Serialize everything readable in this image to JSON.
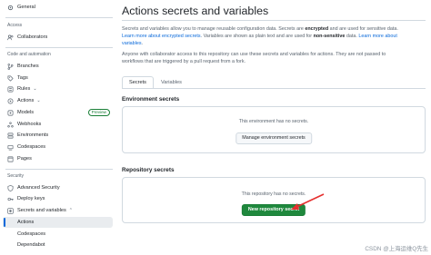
{
  "sidebar": {
    "general": "General",
    "access_heading": "Access",
    "collaborators": "Collaborators",
    "code_heading": "Code and automation",
    "branches": "Branches",
    "tags": "Tags",
    "rules": "Rules",
    "actions": "Actions",
    "models": "Models",
    "models_badge": "Preview",
    "webhooks": "Webhooks",
    "environments": "Environments",
    "codespaces": "Codespaces",
    "pages": "Pages",
    "security_heading": "Security",
    "advanced_security": "Advanced Security",
    "deploy_keys": "Deploy keys",
    "secrets_variables": "Secrets and variables",
    "sub_actions": "Actions",
    "sub_codespaces": "Codespaces",
    "sub_dependabot": "Dependabot"
  },
  "main": {
    "title": "Actions secrets and variables",
    "para1": {
      "t1": "Secrets and variables allow you to manage reusable configuration data. Secrets are ",
      "b1": "encrypted",
      "t2": " and are used for sensitive data. ",
      "link1": "Learn more about encrypted secrets",
      "t3": ". Variables are shown as plain text and are used for ",
      "b2": "non-sensitive",
      "t4": " data. ",
      "link2": "Learn more about variables",
      "t5": "."
    },
    "para2": "Anyone with collaborator access to this repository can use these secrets and variables for actions. They are not passed to workflows that are triggered by a pull request from a fork.",
    "tabs": [
      "Secrets",
      "Variables"
    ],
    "env_title": "Environment secrets",
    "env_empty": "This environment has no secrets.",
    "env_button": "Manage environment secrets",
    "repo_title": "Repository secrets",
    "repo_empty": "This repository has no secrets.",
    "repo_button": "New repository secret"
  },
  "watermark": "CSDN @上海运维Q先生",
  "colors": {
    "accent": "#0969da",
    "primary_button": "#1f883d",
    "annotation_arrow": "#e5302f"
  }
}
